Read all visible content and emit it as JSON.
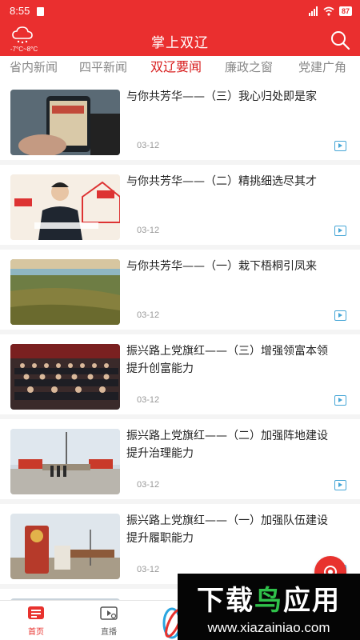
{
  "status": {
    "time": "8:55",
    "battery": "87"
  },
  "header": {
    "weather_temp": "-7°C~8°C",
    "title": "掌上双辽"
  },
  "tabs": [
    {
      "label": "省内新闻",
      "active": false
    },
    {
      "label": "四平新闻",
      "active": false
    },
    {
      "label": "双辽要闻",
      "active": true
    },
    {
      "label": "廉政之窗",
      "active": false
    },
    {
      "label": "党建广角",
      "active": false
    }
  ],
  "news": [
    {
      "title": "与你共芳华——（三）我心归处即是家",
      "date": "03-12"
    },
    {
      "title": "与你共芳华——（二）精挑细选尽其才",
      "date": "03-12"
    },
    {
      "title": "与你共芳华——（一）栽下梧桐引凤来",
      "date": "03-12"
    },
    {
      "title": "振兴路上党旗红——（三）增强领富本领 提升创富能力",
      "date": "03-12"
    },
    {
      "title": "振兴路上党旗红——（二）加强阵地建设 提升治理能力",
      "date": "03-12"
    },
    {
      "title": "振兴路上党旗红——（一）加强队伍建设 提升履职能力",
      "date": "03-12"
    }
  ],
  "bottom_nav": [
    {
      "label": "首页",
      "active": true
    },
    {
      "label": "直播",
      "active": false
    }
  ],
  "watermark": {
    "title_part1": "下载",
    "title_part2": "鸟",
    "title_part3": "应用",
    "url": "www.xiazainiao.com"
  },
  "colors": {
    "brand_red": "#ea2f2f",
    "active_tab": "#d81e1e",
    "video_icon": "#46a6d6"
  }
}
